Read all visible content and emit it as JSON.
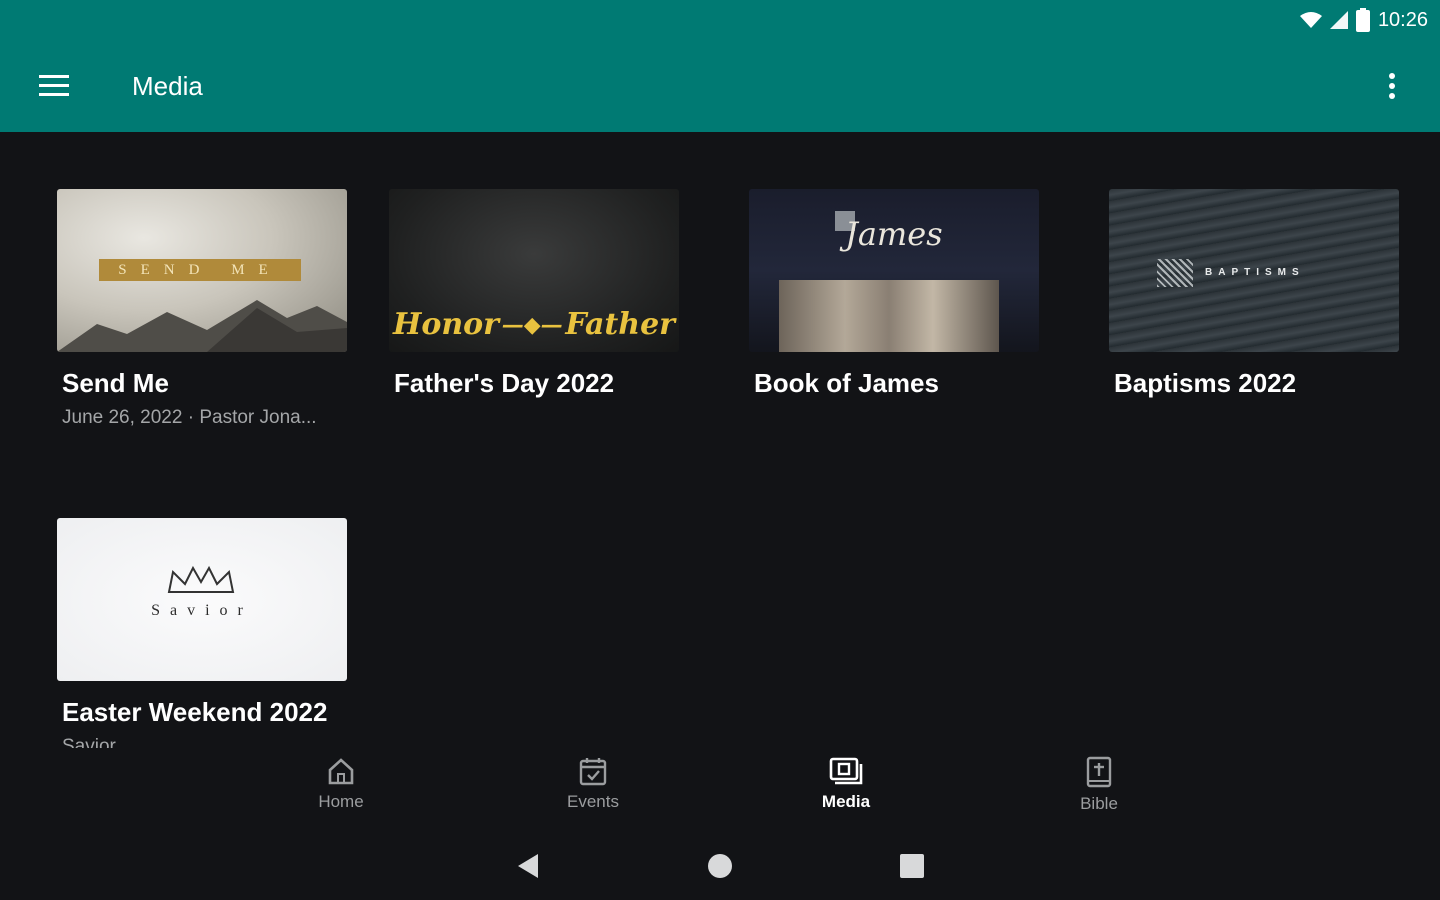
{
  "status_bar": {
    "time": "10:26"
  },
  "app_bar": {
    "title": "Media"
  },
  "cards": [
    {
      "title": "Send Me",
      "subtitle": "June 26, 2022 · Pastor Jona...",
      "thumb_text": "SEND ME"
    },
    {
      "title": "Father's Day 2022",
      "subtitle": "",
      "thumb_left": "Honor",
      "thumb_right": "Father"
    },
    {
      "title": "Book of James",
      "subtitle": "",
      "thumb_text": "James"
    },
    {
      "title": "Baptisms 2022",
      "subtitle": "",
      "thumb_text": "BAPTISMS"
    },
    {
      "title": "Easter Weekend 2022",
      "subtitle": "Savior",
      "thumb_text": "Savior"
    }
  ],
  "bottom_nav": {
    "items": [
      {
        "label": "Home",
        "icon": "home-icon"
      },
      {
        "label": "Events",
        "icon": "calendar-icon"
      },
      {
        "label": "Media",
        "icon": "media-icon",
        "active": true
      },
      {
        "label": "Bible",
        "icon": "bible-icon"
      }
    ]
  },
  "colors": {
    "app_bar": "#007a73",
    "background": "#121316",
    "subtitle": "#a4a6a8",
    "nav_inactive": "#9b9d9f"
  }
}
